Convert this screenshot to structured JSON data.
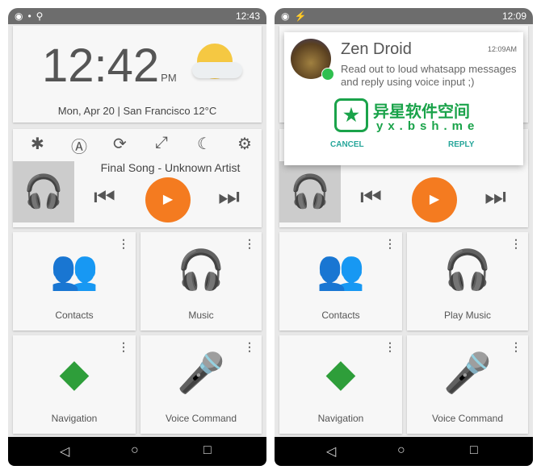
{
  "left": {
    "status_time": "12:43",
    "clock": {
      "time": "12:42",
      "ampm": "PM",
      "date": "Mon, Apr 20 | San Francisco 12°C"
    },
    "song": "Final Song - Unknown Artist",
    "tiles": [
      {
        "label": "Contacts",
        "color": "#1e88e5"
      },
      {
        "label": "Music",
        "color": "#f57c00"
      },
      {
        "label": "Navigation",
        "color": "#2e9e3a"
      },
      {
        "label": "Voice Command",
        "color": "#d32f2f"
      }
    ]
  },
  "right": {
    "status_time": "12:09",
    "dialog": {
      "title": "Zen Droid",
      "time": "12:09AM",
      "message": "Read out to loud whatsapp messages and reply using voice input ;)",
      "cancel": "CANCEL",
      "reply": "REPLY"
    },
    "tiles": [
      {
        "label": "Contacts"
      },
      {
        "label": "Play Music"
      },
      {
        "label": "Navigation"
      },
      {
        "label": "Voice Command"
      }
    ]
  },
  "watermark": {
    "title": "异星软件空间",
    "url": "yx.bsh.me"
  },
  "accent": "#f47b20"
}
